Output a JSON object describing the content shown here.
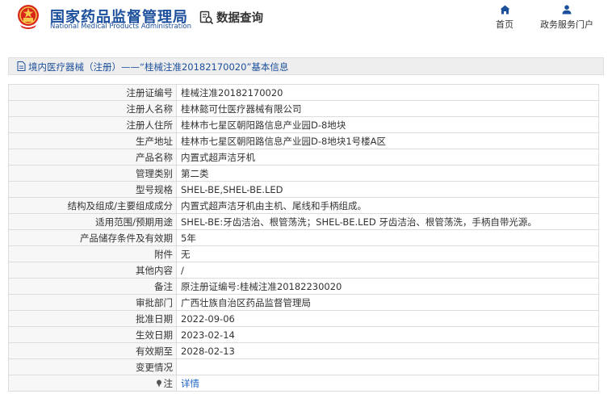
{
  "header": {
    "site_name_cn": "国家药品监督管理局",
    "site_name_en": "National Medical Products Administration",
    "query_label": "数据查询",
    "nav": [
      {
        "label": "首页",
        "icon": "home-icon"
      },
      {
        "label": "政务服务门户",
        "icon": "user-icon"
      }
    ]
  },
  "breadcrumb": {
    "text": "境内医疗器械（注册）——“桂械注准20182170020”基本信息",
    "icon": "document-icon"
  },
  "detail": {
    "rows": [
      {
        "label": "注册证编号",
        "value": "桂械注准20182170020"
      },
      {
        "label": "注册人名称",
        "value": "桂林懿可仕医疗器械有限公司"
      },
      {
        "label": "注册人住所",
        "value": "桂林市七星区朝阳路信息产业园D-8地块"
      },
      {
        "label": "生产地址",
        "value": "桂林市七星区朝阳路信息产业园D-8地块1号楼A区"
      },
      {
        "label": "产品名称",
        "value": "内置式超声洁牙机"
      },
      {
        "label": "管理类别",
        "value": "第二类"
      },
      {
        "label": "型号规格",
        "value": "SHEL-BE,SHEL-BE.LED"
      },
      {
        "label": "结构及组成/主要组成成分",
        "value": "内置式超声洁牙机由主机、尾线和手柄组成。"
      },
      {
        "label": "适用范围/预期用途",
        "value": "SHEL-BE:牙齿洁治、根管荡洗；SHEL-BE.LED 牙齿洁治、根管荡洗，手柄自带光源。"
      },
      {
        "label": "产品储存条件及有效期",
        "value": "5年"
      },
      {
        "label": "附件",
        "value": "无"
      },
      {
        "label": "其他内容",
        "value": "/"
      },
      {
        "label": "备注",
        "value": "原注册证编号:桂械注准20182230020"
      },
      {
        "label": "审批部门",
        "value": "广西壮族自治区药品监督管理局"
      },
      {
        "label": "批准日期",
        "value": "2022-09-06"
      },
      {
        "label": "生效日期",
        "value": "2023-02-14"
      },
      {
        "label": "有效期至",
        "value": "2028-02-13"
      },
      {
        "label": "变更情况",
        "value": ""
      }
    ],
    "note": {
      "label": "注",
      "link_text": "详情",
      "icon": "pin-icon"
    }
  },
  "colors": {
    "brand": "#1c4f9c",
    "link": "#1c64c8",
    "emblem": "#d8261b"
  }
}
